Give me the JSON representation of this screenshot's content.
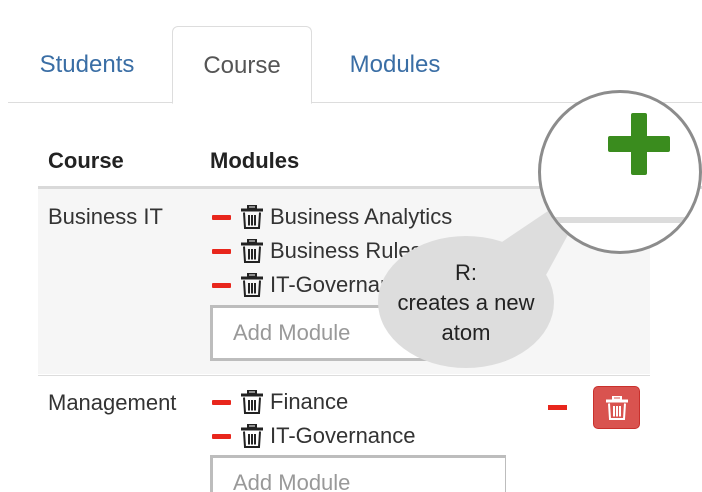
{
  "tabs": [
    {
      "label": "Students",
      "active": false
    },
    {
      "label": "Course",
      "active": true
    },
    {
      "label": "Modules",
      "active": false
    }
  ],
  "table": {
    "headers": [
      "Course",
      "Modules"
    ],
    "rows": [
      {
        "course": "Business IT",
        "modules": [
          "Business Analytics",
          "Business Rules",
          "IT-Governance"
        ],
        "add_placeholder": "Add Module"
      },
      {
        "course": "Management",
        "modules": [
          "Finance",
          "IT-Governance"
        ],
        "add_placeholder": "Add Module"
      }
    ]
  },
  "callout": {
    "line1": "R:",
    "line2": "creates a new",
    "line3": "atom"
  },
  "icons": {
    "remove": "minus-icon",
    "delete": "trash-icon",
    "add": "plus-icon"
  },
  "colors": {
    "tab_link": "#3a6ea5",
    "remove_red": "#e8261c",
    "delete_button": "#d9534f",
    "add_green": "#3a8c1e",
    "callout_bg": "#dddddd"
  }
}
